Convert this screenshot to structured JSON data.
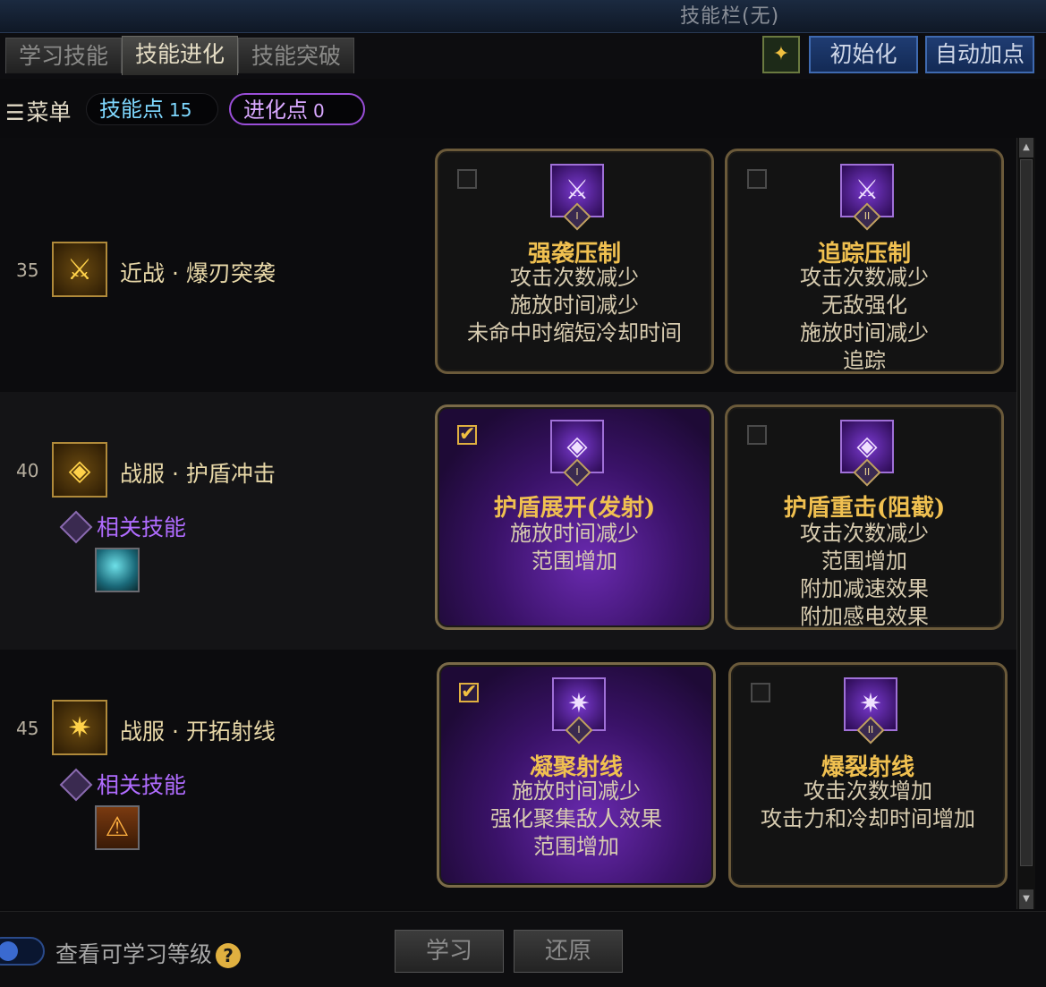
{
  "window": {
    "title": "技能栏(无)"
  },
  "tabs": [
    {
      "label": "学习技能"
    },
    {
      "label": "技能进化"
    },
    {
      "label": "技能突破"
    }
  ],
  "toolbar": {
    "icon": "skill-bar-icon",
    "init_label": "初始化",
    "auto_label": "自动加点"
  },
  "menu": {
    "label": "菜单",
    "skill_points_label": "技能点",
    "skill_points": "15",
    "evo_points_label": "进化点",
    "evo_points": "0"
  },
  "skills": [
    {
      "level": "35",
      "name": "近战 · 爆刃突袭",
      "related_label": "",
      "options": [
        {
          "tier": "I",
          "checked": false,
          "title": "强袭压制",
          "effects": [
            "攻击次数减少",
            "施放时间减少",
            "未命中时缩短冷却时间"
          ]
        },
        {
          "tier": "II",
          "checked": false,
          "title": "追踪压制",
          "effects": [
            "攻击次数减少",
            "无敌强化",
            "施放时间减少",
            "追踪"
          ]
        }
      ]
    },
    {
      "level": "40",
      "name": "战服 · 护盾冲击",
      "related_label": "相关技能",
      "options": [
        {
          "tier": "I",
          "checked": true,
          "title": "护盾展开(发射)",
          "effects": [
            "施放时间减少",
            "范围增加"
          ]
        },
        {
          "tier": "II",
          "checked": false,
          "title": "护盾重击(阻截)",
          "effects": [
            "攻击次数减少",
            "范围增加",
            "附加减速效果",
            "附加感电效果"
          ]
        }
      ]
    },
    {
      "level": "45",
      "name": "战服 · 开拓射线",
      "related_label": "相关技能",
      "options": [
        {
          "tier": "I",
          "checked": true,
          "title": "凝聚射线",
          "effects": [
            "施放时间减少",
            "强化聚集敌人效果",
            "范围增加"
          ]
        },
        {
          "tier": "II",
          "checked": false,
          "title": "爆裂射线",
          "effects": [
            "攻击次数增加",
            "攻击力和冷却时间增加"
          ]
        }
      ]
    }
  ],
  "bottom": {
    "level_toggle_label": "查看可学习等级",
    "learn_label": "学习",
    "restore_label": "还原"
  },
  "colors": {
    "accent_gold": "#f0c050",
    "evo_purple": "#9a4ed8",
    "skill_point_blue": "#7fd8ff"
  }
}
